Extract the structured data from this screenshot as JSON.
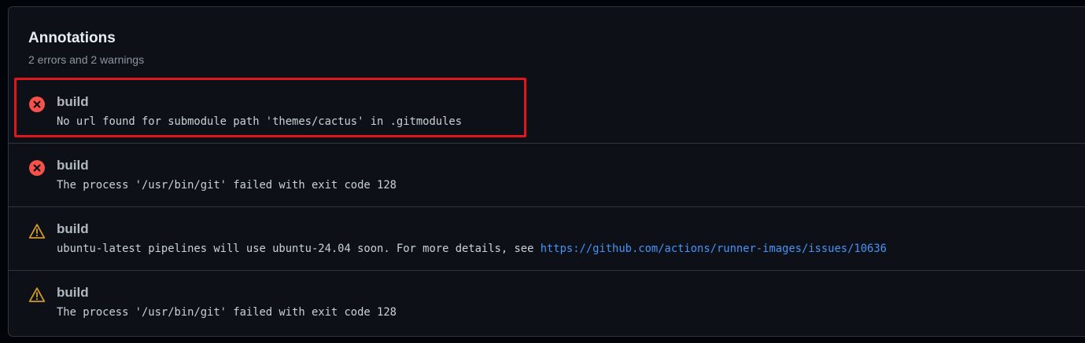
{
  "annotations": {
    "title": "Annotations",
    "summary": "2 errors and 2 warnings",
    "items": [
      {
        "severity": "error",
        "icon": "x-circle-icon",
        "title": "build",
        "message": "No url found for submodule path 'themes/cactus' in .gitmodules",
        "link": null
      },
      {
        "severity": "error",
        "icon": "x-circle-icon",
        "title": "build",
        "message": "The process '/usr/bin/git' failed with exit code 128",
        "link": null
      },
      {
        "severity": "warning",
        "icon": "alert-triangle-icon",
        "title": "build",
        "message": "ubuntu-latest pipelines will use ubuntu-24.04 soon. For more details, see ",
        "link": "https://github.com/actions/runner-images/issues/10636"
      },
      {
        "severity": "warning",
        "icon": "alert-triangle-icon",
        "title": "build",
        "message": "The process '/usr/bin/git' failed with exit code 128",
        "link": null
      }
    ]
  },
  "colors": {
    "error": "#f85149",
    "warning": "#d29922",
    "link": "#4493f8",
    "highlight_box": "#e0161f"
  }
}
